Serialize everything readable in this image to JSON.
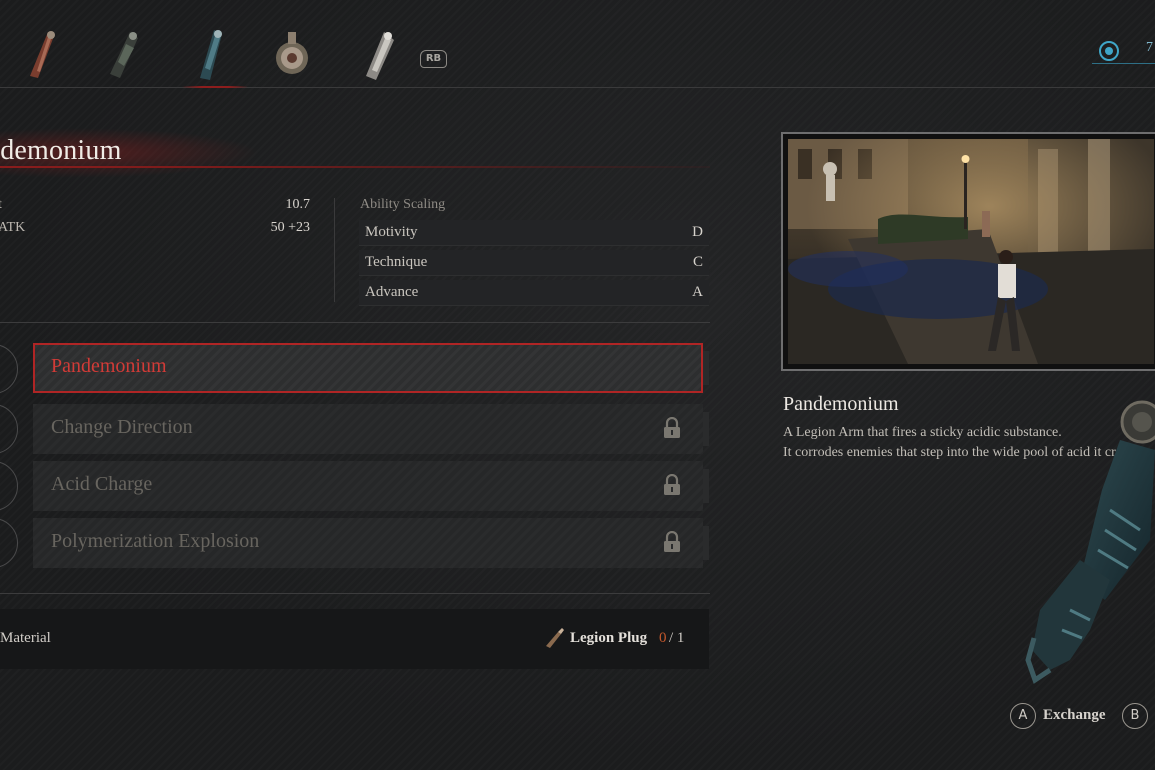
{
  "top_bar": {
    "tabs": [
      {
        "name": "legion-arm-tab-1",
        "icon": "legion-arm-icon"
      },
      {
        "name": "legion-arm-tab-2",
        "icon": "legion-arm-icon"
      },
      {
        "name": "legion-arm-tab-3",
        "icon": "legion-arm-icon",
        "active": true
      },
      {
        "name": "legion-arm-tab-4",
        "icon": "legion-arm-icon"
      },
      {
        "name": "legion-arm-tab-5",
        "icon": "legion-arm-icon"
      }
    ],
    "rb_label": "RB",
    "currency_value": "7"
  },
  "item": {
    "title": "Pandemonium",
    "title_display": "ndemonium",
    "stats": [
      {
        "label": "t",
        "value": "10.7"
      },
      {
        "label": "ATK",
        "value": "50 +23"
      }
    ]
  },
  "ability_scaling": {
    "title": "Ability Scaling",
    "rows": [
      {
        "name": "Motivity",
        "grade": "D"
      },
      {
        "name": "Technique",
        "grade": "C"
      },
      {
        "name": "Advance",
        "grade": "A"
      }
    ]
  },
  "skills": [
    {
      "label": "Pandemonium",
      "selected": true,
      "locked": false
    },
    {
      "label": "Change Direction",
      "selected": false,
      "locked": true
    },
    {
      "label": "Acid Charge",
      "selected": false,
      "locked": true
    },
    {
      "label": "Polymerization Explosion",
      "selected": false,
      "locked": true
    }
  ],
  "material": {
    "label": "Material",
    "item_name": "Legion Plug",
    "owned": "0",
    "required_text": "/ 1"
  },
  "info": {
    "title": "Pandemonium",
    "description": [
      "A Legion Arm that fires a sticky acidic substance.",
      "It corrodes enemies that step into the wide pool of acid it creates."
    ]
  },
  "prompts": {
    "confirm_button": "A",
    "confirm_label": "Exchange",
    "back_button": "B"
  },
  "colors": {
    "accent_red": "#b02525",
    "selected_text": "#d23b37",
    "material_count": "#c4582c"
  }
}
